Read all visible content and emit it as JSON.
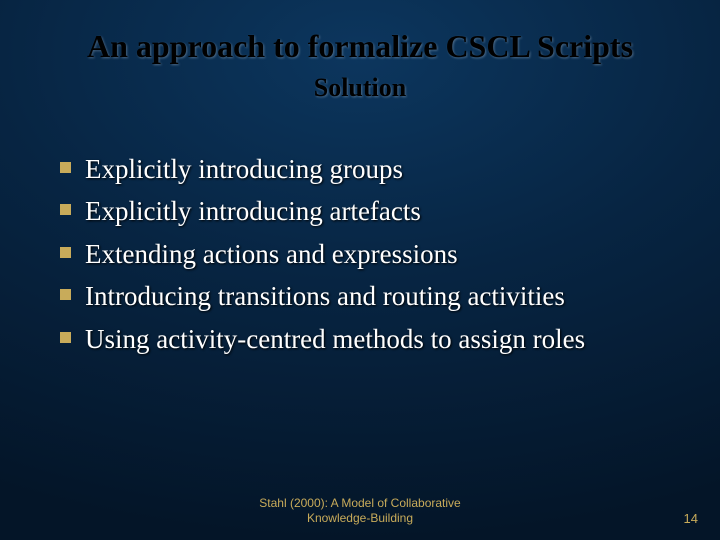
{
  "title": "An approach to formalize CSCL Scripts",
  "subtitle": "Solution",
  "bullets": [
    "Explicitly introducing groups",
    "Explicitly introducing artefacts",
    "Extending actions and expressions",
    "Introducing transitions and routing activities",
    "Using activity-centred methods to assign roles"
  ],
  "footer": {
    "line1": "Stahl (2000): A Model of Collaborative",
    "line2": "Knowledge-Building"
  },
  "page_number": "14"
}
